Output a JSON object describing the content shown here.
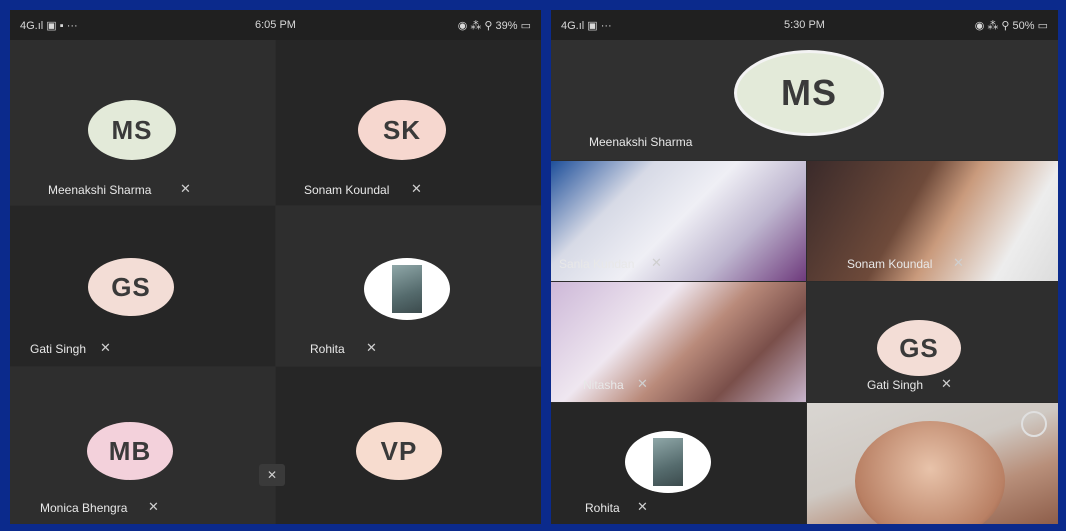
{
  "left_phone": {
    "status": {
      "signal": "4G.ıl ▣ ▪ ···",
      "time": "6:05 PM",
      "right": "◉ ⁂ ⚲ 39% ▭"
    },
    "tiles": [
      {
        "initials": "MS",
        "name": "Meenakshi Sharma"
      },
      {
        "initials": "SK",
        "name": "Sonam Koundal"
      },
      {
        "initials": "GS",
        "name": "Gati Singh"
      },
      {
        "name": "Rohita"
      },
      {
        "initials": "MB",
        "name": "Monica Bhengra"
      },
      {
        "initials": "VP"
      }
    ]
  },
  "right_phone": {
    "status": {
      "signal": "4G.ıl ▣ ···",
      "time": "5:30 PM",
      "right": "◉ ⁂ ⚲ 50% ▭"
    },
    "main": {
      "initials": "MS",
      "name": "Meenakshi Sharma"
    },
    "tiles": [
      {
        "name": "Sanla Kundan"
      },
      {
        "name": "Sonam Koundal"
      },
      {
        "name": "Nitasha"
      },
      {
        "initials": "GS",
        "name": "Gati Singh"
      },
      {
        "name": "Rohita"
      }
    ]
  },
  "mic_icon": "muted-mic-icon",
  "colors": {
    "frame": "#0b2a8c",
    "tile": "#2e2e2e",
    "ms": "#e3ead9",
    "sk": "#f6d7cf",
    "gs": "#f3ddd6",
    "mb": "#f3d1db",
    "vp": "#f7dccf"
  }
}
